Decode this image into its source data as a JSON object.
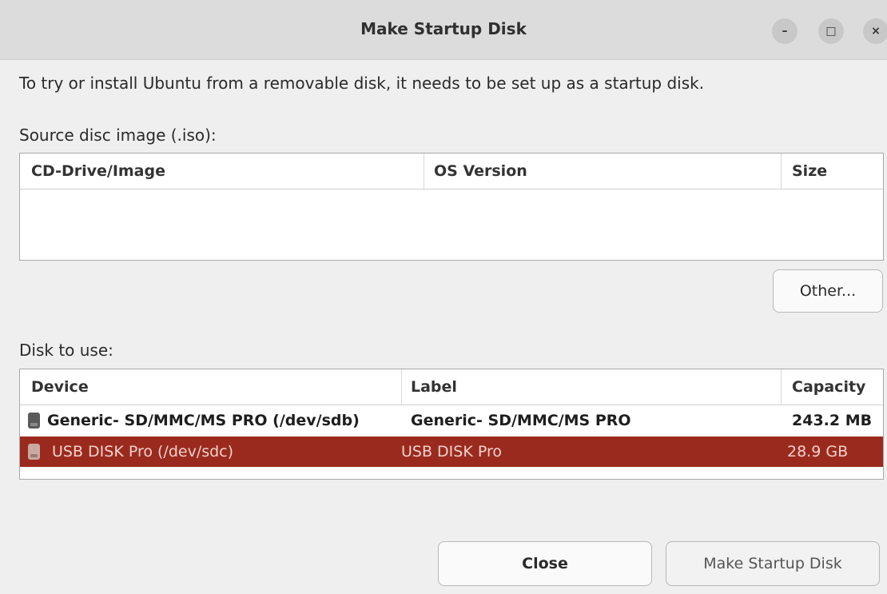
{
  "window": {
    "title": "Make Startup Disk",
    "controls": {
      "minimize": "–",
      "maximize": "□",
      "close": "×"
    }
  },
  "intro_text": "To try or install Ubuntu from a removable disk, it needs to be set up as a startup disk.",
  "source": {
    "label": "Source disc image (.iso):",
    "columns": [
      "CD-Drive/Image",
      "OS Version",
      "Size"
    ],
    "rows": [],
    "other_button": "Other..."
  },
  "disk": {
    "label": "Disk to use:",
    "columns": [
      "Device",
      "Label",
      "Capacity"
    ],
    "rows": [
      {
        "device": "Generic- SD/MMC/MS PRO (/dev/sdb)",
        "label": "Generic- SD/MMC/MS PRO",
        "capacity": "243.2 MB",
        "selected": false
      },
      {
        "device": "USB DISK Pro (/dev/sdc)",
        "label": "USB DISK Pro",
        "capacity": "28.9 GB",
        "selected": true
      }
    ]
  },
  "buttons": {
    "close": "Close",
    "make": "Make Startup Disk"
  },
  "colors": {
    "selection": "#9b2a1e",
    "titlebar": "#dcdcdc"
  }
}
